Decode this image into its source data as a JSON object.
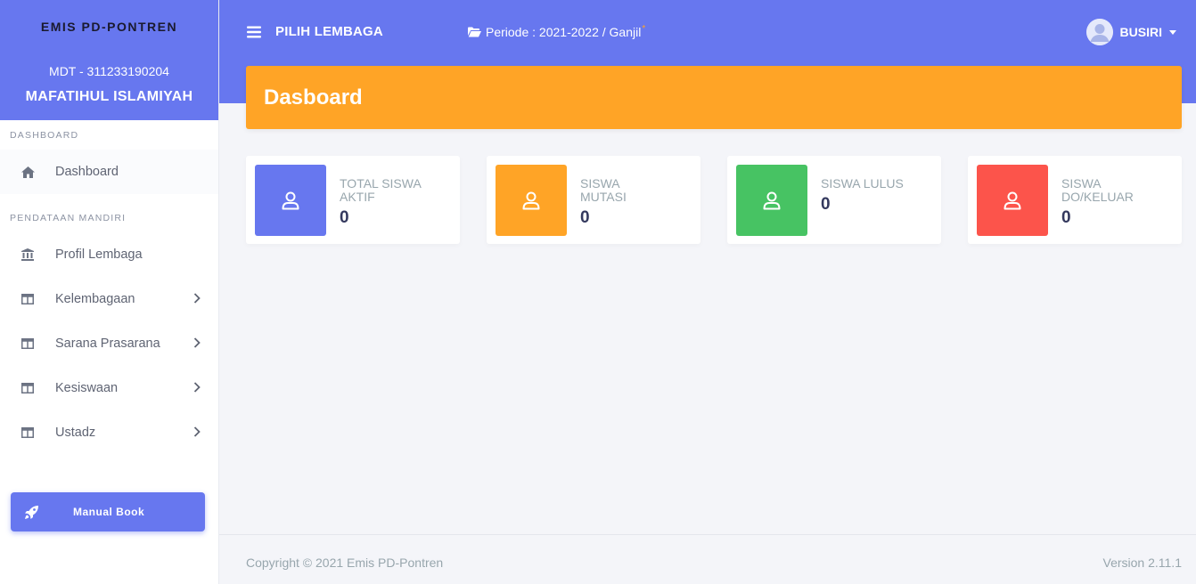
{
  "sidebar": {
    "app_name": "EMIS PD-PONTREN",
    "institution_code": "MDT - 311233190204",
    "institution_name": "MAFATIHUL ISLAMIYAH",
    "sections": [
      {
        "header": "DASHBOARD",
        "items": [
          {
            "label": "Dashboard",
            "icon": "home-icon",
            "active": true
          }
        ]
      },
      {
        "header": "PENDATAAN MANDIRI",
        "items": [
          {
            "label": "Profil Lembaga",
            "icon": "institution-icon"
          },
          {
            "label": "Kelembagaan",
            "icon": "table-icon",
            "expandable": true
          },
          {
            "label": "Sarana Prasarana",
            "icon": "table-icon",
            "expandable": true
          },
          {
            "label": "Kesiswaan",
            "icon": "table-icon",
            "expandable": true
          },
          {
            "label": "Ustadz",
            "icon": "table-icon",
            "expandable": true
          }
        ]
      }
    ],
    "manual_button": "Manual Book"
  },
  "topbar": {
    "pick_label": "PILIH LEMBAGA",
    "periode": "Periode : 2021-2022 / Ganjil",
    "periode_marker": "*",
    "user_name": "BUSIRI"
  },
  "page_title": "Dasboard",
  "stats": [
    {
      "title": "TOTAL SISWA AKTIF",
      "value": "0",
      "color": "#6777ef"
    },
    {
      "title": "SISWA MUTASI",
      "value": "0",
      "color": "#ffa426"
    },
    {
      "title": "SISWA LULUS",
      "value": "0",
      "color": "#47c363"
    },
    {
      "title": "SISWA DO/KELUAR",
      "value": "0",
      "color": "#fc544b"
    }
  ],
  "footer": {
    "copyright": "Copyright © 2021 Emis PD-Pontren",
    "version": "Version 2.11.1"
  },
  "colors": {
    "primary": "#6777ef",
    "warning": "#ffa426",
    "success": "#47c363",
    "danger": "#fc544b"
  }
}
